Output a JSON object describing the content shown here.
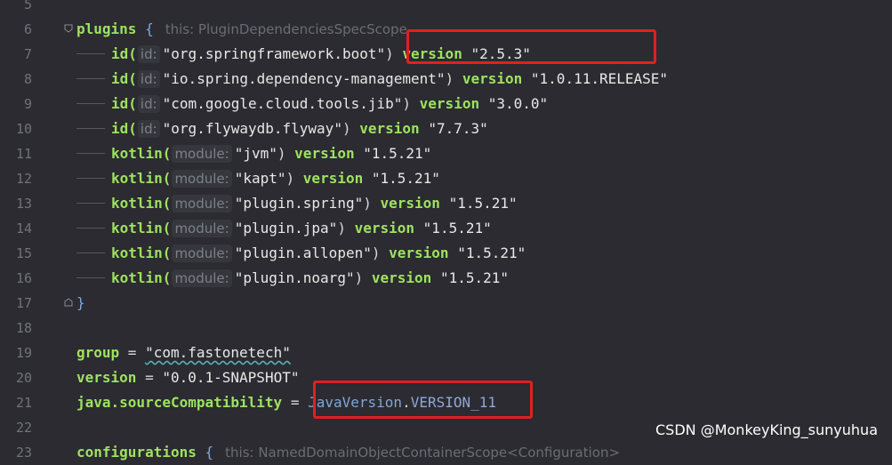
{
  "lines": [
    {
      "n": "5"
    },
    {
      "n": "6",
      "kw": "plugins",
      "brace": "{",
      "hint": "this: PluginDependenciesSpecScope"
    },
    {
      "n": "7",
      "fn": "id(",
      "pname": "id:",
      "arg": "\"org.springframework.boot\"",
      "close": ")",
      "ver": "version",
      "val": "\"2.5.3\""
    },
    {
      "n": "8",
      "fn": "id(",
      "pname": "id:",
      "arg": "\"io.spring.dependency-management\"",
      "close": ")",
      "ver": "version",
      "val": "\"1.0.11.RELEASE\""
    },
    {
      "n": "9",
      "fn": "id(",
      "pname": "id:",
      "arg": "\"com.google.cloud.tools.jib\"",
      "close": ")",
      "ver": "version",
      "val": "\"3.0.0\""
    },
    {
      "n": "10",
      "fn": "id(",
      "pname": "id:",
      "arg": "\"org.flywaydb.flyway\"",
      "close": ")",
      "ver": "version",
      "val": "\"7.7.3\""
    },
    {
      "n": "11",
      "fn": "kotlin(",
      "pname": "module:",
      "arg": "\"jvm\"",
      "close": ")",
      "ver": "version",
      "val": "\"1.5.21\""
    },
    {
      "n": "12",
      "fn": "kotlin(",
      "pname": "module:",
      "arg": "\"kapt\"",
      "close": ")",
      "ver": "version",
      "val": "\"1.5.21\""
    },
    {
      "n": "13",
      "fn": "kotlin(",
      "pname": "module:",
      "arg": "\"plugin.spring\"",
      "close": ")",
      "ver": "version",
      "val": "\"1.5.21\""
    },
    {
      "n": "14",
      "fn": "kotlin(",
      "pname": "module:",
      "arg": "\"plugin.jpa\"",
      "close": ")",
      "ver": "version",
      "val": "\"1.5.21\""
    },
    {
      "n": "15",
      "fn": "kotlin(",
      "pname": "module:",
      "arg": "\"plugin.allopen\"",
      "close": ")",
      "ver": "version",
      "val": "\"1.5.21\""
    },
    {
      "n": "16",
      "fn": "kotlin(",
      "pname": "module:",
      "arg": "\"plugin.noarg\"",
      "close": ")",
      "ver": "version",
      "val": "\"1.5.21\""
    },
    {
      "n": "17",
      "brace": "}"
    },
    {
      "n": "18"
    },
    {
      "n": "19",
      "prop": "group",
      "eq": " = ",
      "val": "\"com.fastonetech\""
    },
    {
      "n": "20",
      "prop": "version",
      "eq": " = ",
      "val": "\"0.0.1-SNAPSHOT\""
    },
    {
      "n": "21",
      "prop": "java.sourceCompatibility",
      "eq": " = ",
      "ident": "JavaVersion",
      "dot": ".",
      "const": "VERSION_11"
    },
    {
      "n": "22"
    },
    {
      "n": "23",
      "kw": "configurations",
      "brace": "{",
      "hint": "this: NamedDomainObjectContainerScope<Configuration>"
    }
  ],
  "watermark": "CSDN @MonkeyKing_sunyuhua",
  "colors": {
    "background": "#2b2b31",
    "keyword": "#9ee25f",
    "highlight": "#e02020"
  }
}
